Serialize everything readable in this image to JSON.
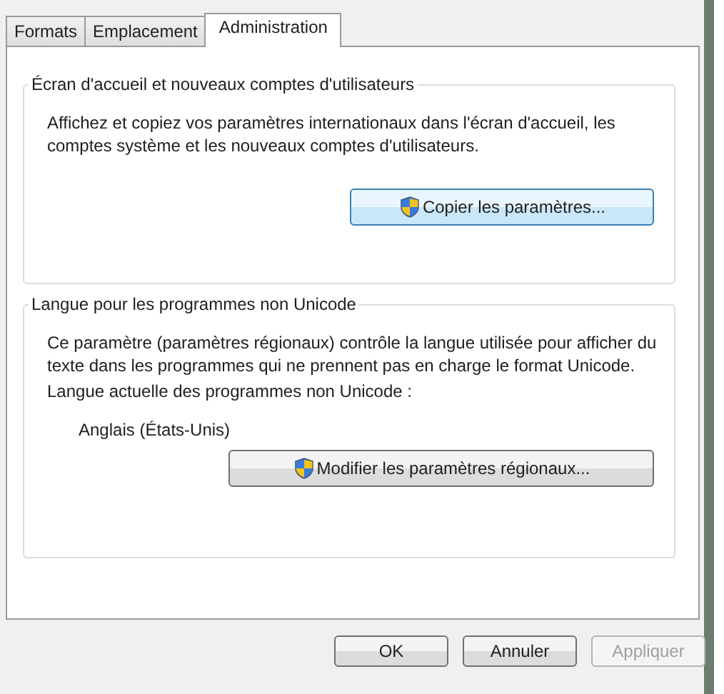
{
  "tabs": [
    {
      "label": "Formats",
      "selected": false
    },
    {
      "label": "Emplacement",
      "selected": false
    },
    {
      "label": "Administration",
      "selected": true
    }
  ],
  "groups": [
    {
      "title": "Écran d'accueil et nouveaux comptes d'utilisateurs",
      "text": "Affichez et copiez vos paramètres internationaux dans l'écran d'accueil, les comptes système et les nouveaux comptes d'utilisateurs.",
      "button": "Copier les paramètres..."
    },
    {
      "title": "Langue pour les programmes non Unicode",
      "text": "Ce paramètre (paramètres régionaux) contrôle la langue utilisée pour afficher du texte dans les programmes qui ne prennent pas en charge le format Unicode.",
      "current_label": "Langue actuelle des programmes non Unicode :",
      "current_value": "Anglais (États-Unis)",
      "button": "Modifier les paramètres régionaux..."
    }
  ],
  "buttons": [
    {
      "label": "OK",
      "disabled": false
    },
    {
      "label": "Annuler",
      "disabled": false
    },
    {
      "label": "Appliquer",
      "disabled": true
    }
  ]
}
